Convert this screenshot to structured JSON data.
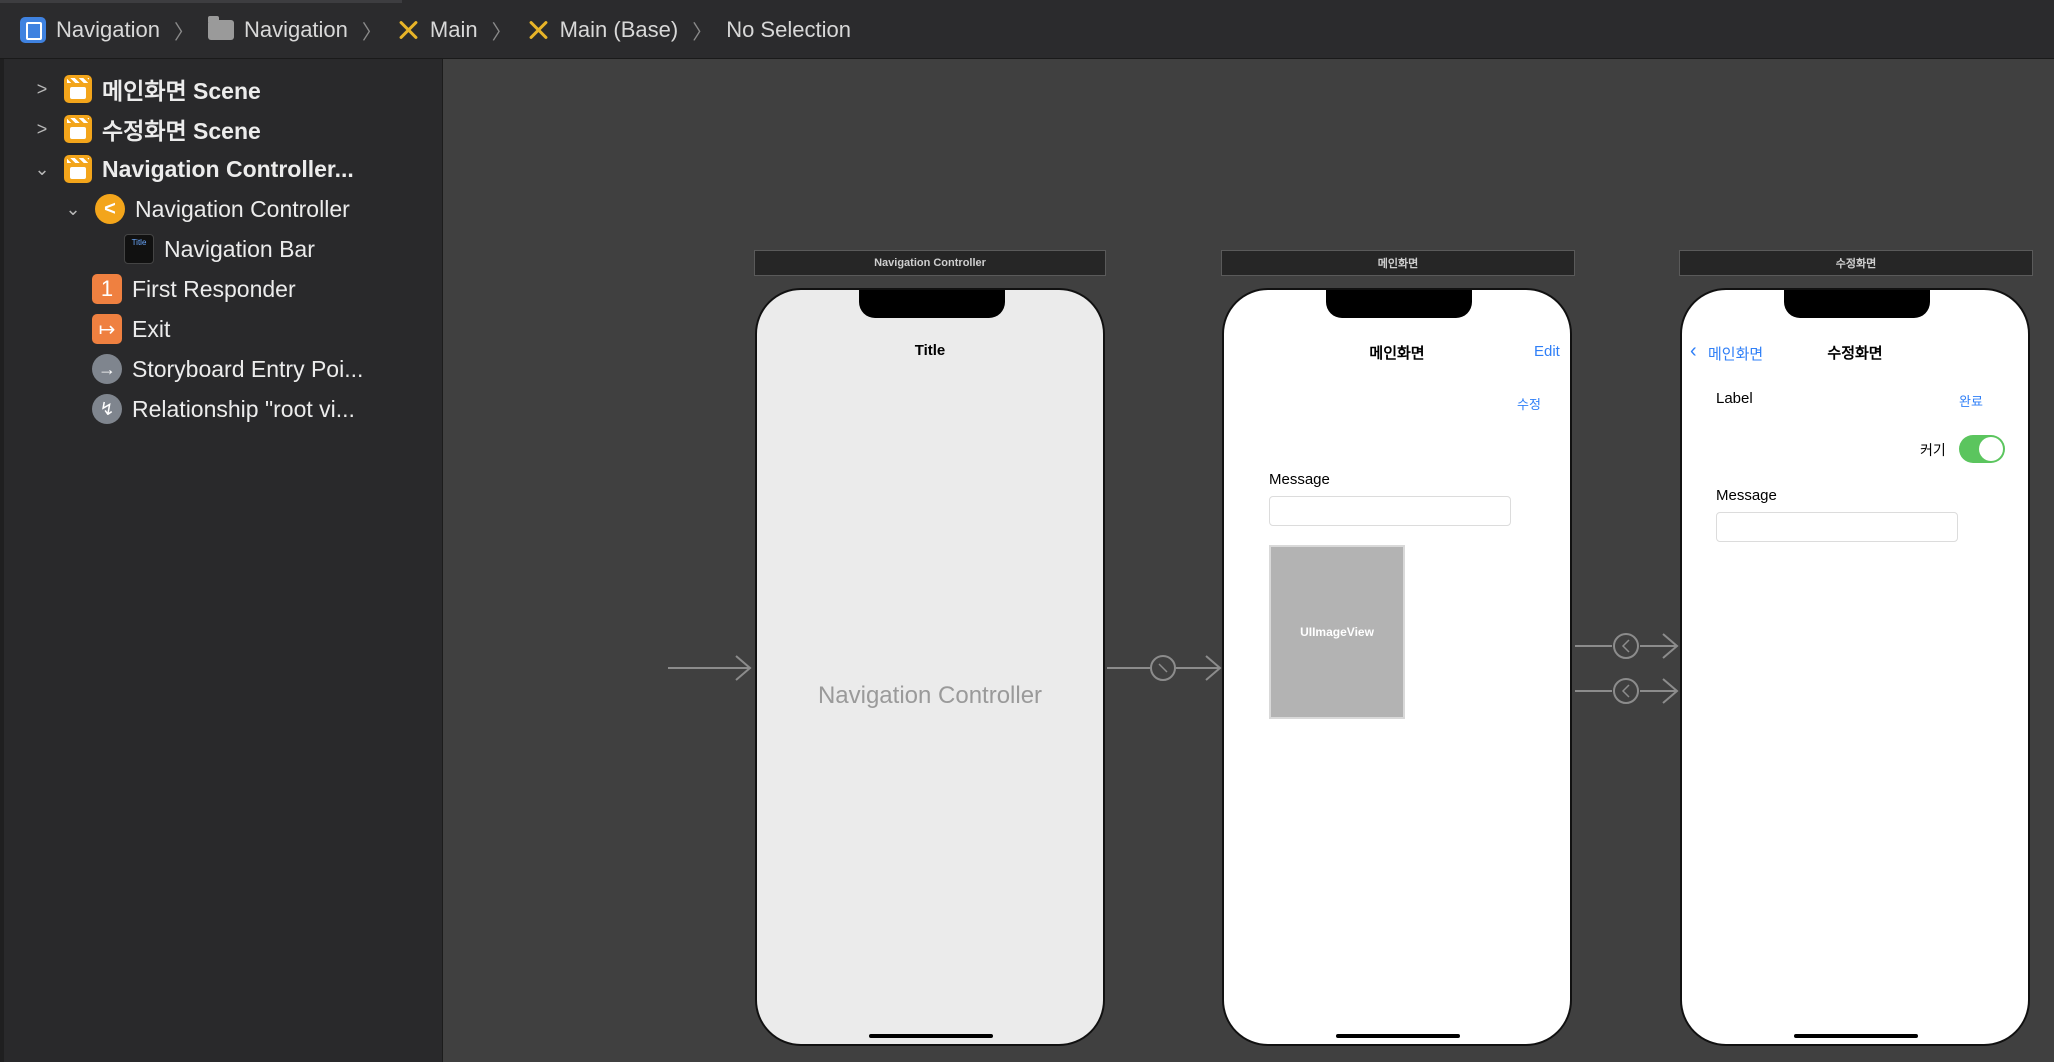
{
  "breadcrumb": {
    "items": [
      {
        "label": "Navigation",
        "icon": "xcode-project-icon"
      },
      {
        "label": "Navigation",
        "icon": "folder-icon"
      },
      {
        "label": "Main",
        "icon": "storyboard-icon"
      },
      {
        "label": "Main (Base)",
        "icon": "storyboard-icon"
      },
      {
        "label": "No Selection"
      }
    ]
  },
  "outline": {
    "items": [
      {
        "label": "메인화면 Scene",
        "icon": "scene-icon",
        "expanded": false
      },
      {
        "label": "수정화면 Scene",
        "icon": "scene-icon",
        "expanded": false
      },
      {
        "label": "Navigation Controller...",
        "icon": "scene-icon",
        "expanded": true
      },
      {
        "label": "Navigation Controller",
        "icon": "navigation-controller-icon",
        "expanded": true
      },
      {
        "label": "Navigation Bar",
        "icon": "navigation-bar-icon",
        "thumb": "Title"
      },
      {
        "label": "First Responder",
        "icon": "first-responder-icon",
        "glyph": "1"
      },
      {
        "label": "Exit",
        "icon": "exit-icon"
      },
      {
        "label": "Storyboard Entry Poi...",
        "icon": "entry-point-icon"
      },
      {
        "label": "Relationship \"root vi...",
        "icon": "relationship-icon"
      }
    ]
  },
  "canvas": {
    "nav_scene": {
      "header": "Navigation Controller",
      "nav_title": "Title",
      "placeholder": "Navigation Controller"
    },
    "main_scene": {
      "header": "메인화면",
      "nav_title": "메인화면",
      "edit_button": "Edit",
      "modify_button": "수정",
      "message_label": "Message",
      "image_view": "UIImageView"
    },
    "edit_scene": {
      "header": "수정화면",
      "back_button": "메인화면",
      "nav_title": "수정화면",
      "label": "Label",
      "done_button": "완료",
      "zoom_label": "커기",
      "switch_on": true,
      "message_label": "Message"
    }
  },
  "colors": {
    "canvas": "#404040",
    "sidebar": "#29292b",
    "accent_blue": "#2f7ff7",
    "switch_green": "#5bc55e",
    "scene_icon": "#f3a51b"
  }
}
